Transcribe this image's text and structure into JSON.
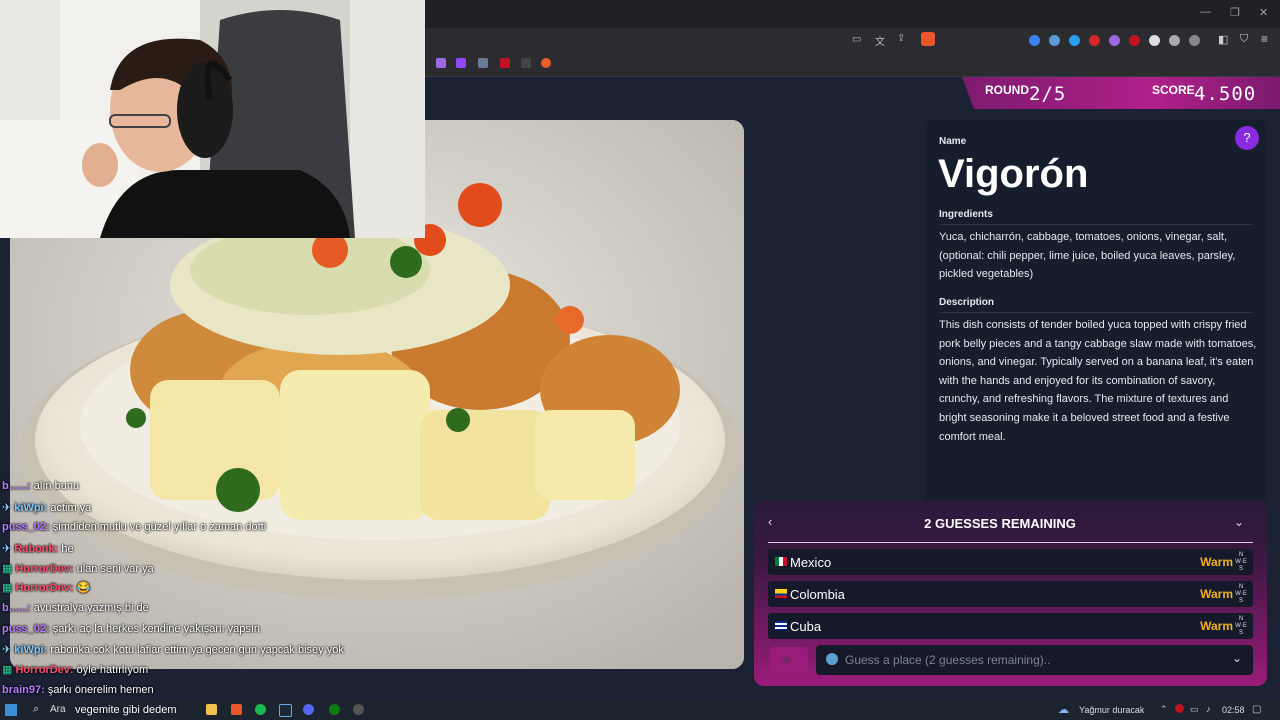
{
  "header": {
    "round_label": "ROUND",
    "round_value": "2/5",
    "score_label": "SCORE",
    "score_value": "4.500"
  },
  "dish": {
    "name_label": "Name",
    "name": "Vigorón",
    "ingredients_label": "Ingredients",
    "ingredients": "Yuca, chicharrón, cabbage, tomatoes, onions, vinegar, salt, (optional: chili pepper, lime juice, boiled yuca leaves, parsley, pickled vegetables)",
    "description_label": "Description",
    "description": "This dish consists of tender boiled yuca topped with crispy fried pork belly pieces and a tangy cabbage slaw made with tomatoes, onions, and vinegar. Typically served on a banana leaf, it's eaten with the hands and enjoyed for its combination of savory, crunchy, and refreshing flavors. The mixture of textures and bright seasoning make it a beloved street food and a festive comfort meal."
  },
  "guesses": {
    "title": "2 GUESSES REMAINING",
    "items": [
      {
        "country": "Mexico",
        "result": "Warm",
        "flag": "mexico-flag"
      },
      {
        "country": "Colombia",
        "result": "Warm",
        "flag": "colombia-flag"
      },
      {
        "country": "Cuba",
        "result": "Warm",
        "flag": "cuba-flag"
      }
    ],
    "placeholder": "Guess a place (2 guesses remaining).."
  },
  "chat": [
    {
      "user": "b......:",
      "msg": "alın bunu",
      "color": "#b67cff"
    },
    {
      "user": "kiWpi:",
      "msg": "actim ya",
      "color": "#7ec8ff"
    },
    {
      "user": "puss_02:",
      "msg": "şimdiden mutlu ve güzel yıllar o zaman dotti",
      "color": "#b67cff"
    },
    {
      "user": "Rabonk:",
      "msg": "he",
      "color": "#ff4d6d"
    },
    {
      "user": "HorrorDev:",
      "msg": "ulan seni var ya",
      "color": "#ff4d6d"
    },
    {
      "user": "HorrorDev:",
      "msg": "",
      "color": "#ff4d6d"
    },
    {
      "user": "b......:",
      "msg": "avustralya yazmış bi de",
      "color": "#b67cff"
    },
    {
      "user": "puss_02:",
      "msg": "şarkı aç la herkes kendine yakışanı yapsın",
      "color": "#b67cff"
    },
    {
      "user": "kiWpi:",
      "msg": "rabonka cok kotu laflar ettim ya gecen gun yapcak bisey yok",
      "color": "#7ec8ff"
    },
    {
      "user": "HorrorDev:",
      "msg": "öyle hatırlıyom",
      "color": "#ff4d6d"
    },
    {
      "user": "brain97:",
      "msg": "şarkı önerelim hemen",
      "color": "#b67cff"
    },
    {
      "user": "......",
      "msg": "vegemite gibi dedem",
      "color": "#ff4d6d"
    }
  ],
  "taskbar": {
    "search_label": "Ara",
    "weather": "Yağmur duracak",
    "time": "02:58"
  }
}
